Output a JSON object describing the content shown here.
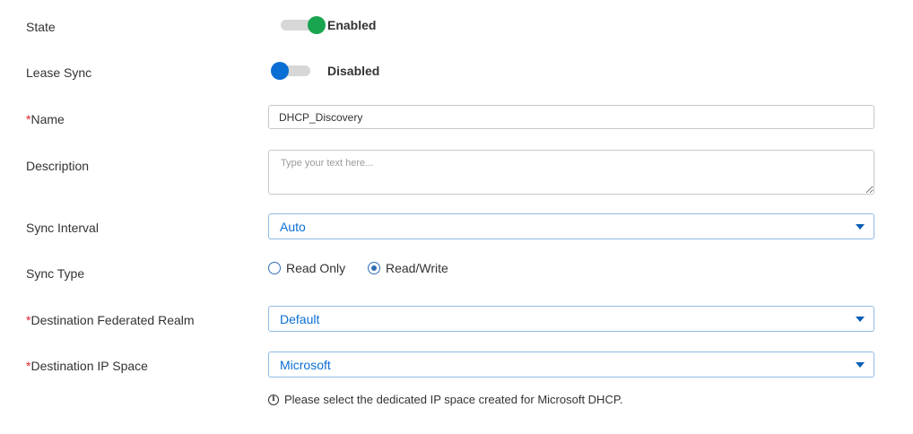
{
  "form": {
    "state": {
      "label": "State",
      "status": "Enabled"
    },
    "lease_sync": {
      "label": "Lease Sync",
      "status": "Disabled"
    },
    "name": {
      "required_mark": "*",
      "label": "Name",
      "value": "DHCP_Discovery"
    },
    "description": {
      "label": "Description",
      "placeholder": "Type your text here..."
    },
    "sync_interval": {
      "label": "Sync Interval",
      "value": "Auto"
    },
    "sync_type": {
      "label": "Sync Type",
      "options": [
        "Read Only",
        "Read/Write"
      ],
      "selected": "Read/Write"
    },
    "destination_realm": {
      "required_mark": "*",
      "label": "Destination Federated Realm",
      "value": "Default"
    },
    "destination_ip_space": {
      "required_mark": "*",
      "label": "Destination IP Space",
      "value": "Microsoft"
    },
    "hint": {
      "icon": "info-icon",
      "text": "Please select the dedicated IP space created for Microsoft DHCP."
    }
  },
  "colors": {
    "toggle_on": "#19a550",
    "toggle_off": "#0a6fd4",
    "required": "#d9232d",
    "select_text": "#0a6fd4"
  }
}
